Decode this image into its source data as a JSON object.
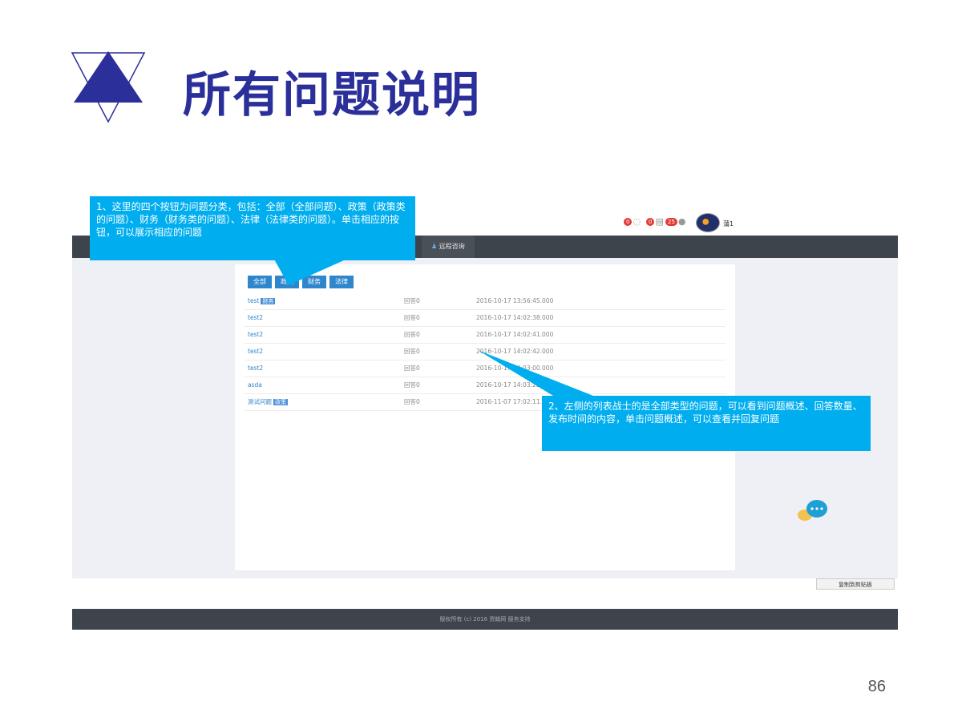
{
  "slide": {
    "title": "所有问题说明",
    "page_number": "86"
  },
  "topbar": {
    "notifications": [
      {
        "count": "0",
        "icon": "bell-icon"
      },
      {
        "count": "0",
        "icon": "calendar-icon"
      },
      {
        "count": "25",
        "icon": "message-icon"
      }
    ],
    "username": "蒲1"
  },
  "nav": {
    "active_tab": "远程咨询",
    "active_tab_icon": "person-icon"
  },
  "filters": [
    "全部",
    "政策",
    "财务",
    "法律"
  ],
  "questions": [
    {
      "title": "test",
      "tag": "财务",
      "answers": "回答0",
      "time": "2016-10-17 13:56:45.000"
    },
    {
      "title": "test2",
      "tag": "",
      "answers": "回答0",
      "time": "2016-10-17 14:02:38.000"
    },
    {
      "title": "test2",
      "tag": "",
      "answers": "回答0",
      "time": "2016-10-17 14:02:41.000"
    },
    {
      "title": "test2",
      "tag": "",
      "answers": "回答0",
      "time": "2016-10-17 14:02:42.000"
    },
    {
      "title": "test2",
      "tag": "",
      "answers": "回答0",
      "time": "2016-10-17 14:03:00.000"
    },
    {
      "title": "asda",
      "tag": "",
      "answers": "回答0",
      "time": "2016-10-17 14:03:22.000"
    },
    {
      "title": "测试问题",
      "tag": "政策",
      "answers": "回答0",
      "time": "2016-11-07 17:02:11.000"
    }
  ],
  "copy_button": "复制到剪贴板",
  "footer": "版权所有 (c) 2016 资翰网 服务支持",
  "callouts": {
    "one": "1、这里的四个按钮为问题分类，包括：全部（全部问题）、政策（政策类的问题）、财务（财务类的问题）、法律（法律类的问题）。单击相应的按钮，可以展示相应的问题",
    "two": "2、左侧的列表战士的是全部类型的问题，可以看到问题概述、回答数量、发布时间的内容，单击问题概述，可以查看并回复问题"
  },
  "colors": {
    "title": "#2b2f9a",
    "callout": "#00aeef",
    "navbar": "#3e444c",
    "filter_button": "#2e86cc",
    "link": "#2e86cc"
  }
}
